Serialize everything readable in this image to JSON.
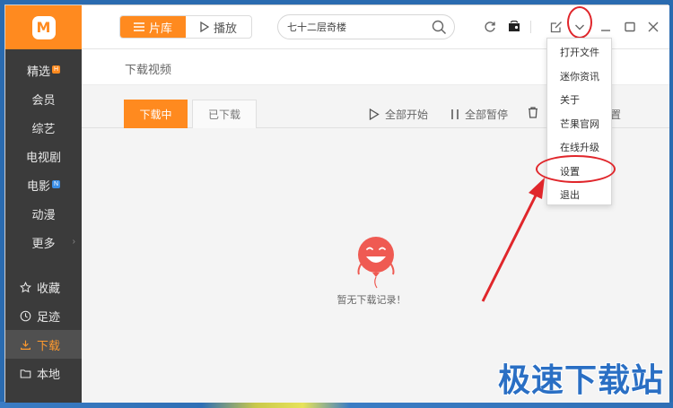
{
  "app": {
    "logo_glyph": "M"
  },
  "sidebar": {
    "items": [
      {
        "label": "精选",
        "badge": "H"
      },
      {
        "label": "会员"
      },
      {
        "label": "综艺"
      },
      {
        "label": "电视剧"
      },
      {
        "label": "电影",
        "badge": "N"
      },
      {
        "label": "动漫"
      },
      {
        "label": "更多",
        "arrow": "›"
      }
    ],
    "bottom_items": [
      {
        "label": "收藏",
        "icon": "star-icon"
      },
      {
        "label": "足迹",
        "icon": "clock-icon"
      },
      {
        "label": "下载",
        "icon": "download-icon",
        "active": true
      },
      {
        "label": "本地",
        "icon": "folder-icon"
      }
    ]
  },
  "topbar": {
    "library_label": "片库",
    "play_label": "播放",
    "search_value": "七十二层奇楼"
  },
  "content": {
    "title": "下载视频",
    "tab_downloading": "下载中",
    "tab_downloaded": "已下载",
    "action_start_all": "全部开始",
    "action_pause_all": "全部暂停",
    "action_settings_partial": "置",
    "empty_text": "暂无下载记录！"
  },
  "menu": {
    "items": [
      "打开文件",
      "迷你资讯",
      "关于",
      "芒果官网",
      "在线升级",
      "设置",
      "退出"
    ]
  },
  "watermark": "极速下载站",
  "colors": {
    "accent": "#ff8a1f",
    "sidebar": "#3b3b3b",
    "highlight": "#e0262b"
  }
}
